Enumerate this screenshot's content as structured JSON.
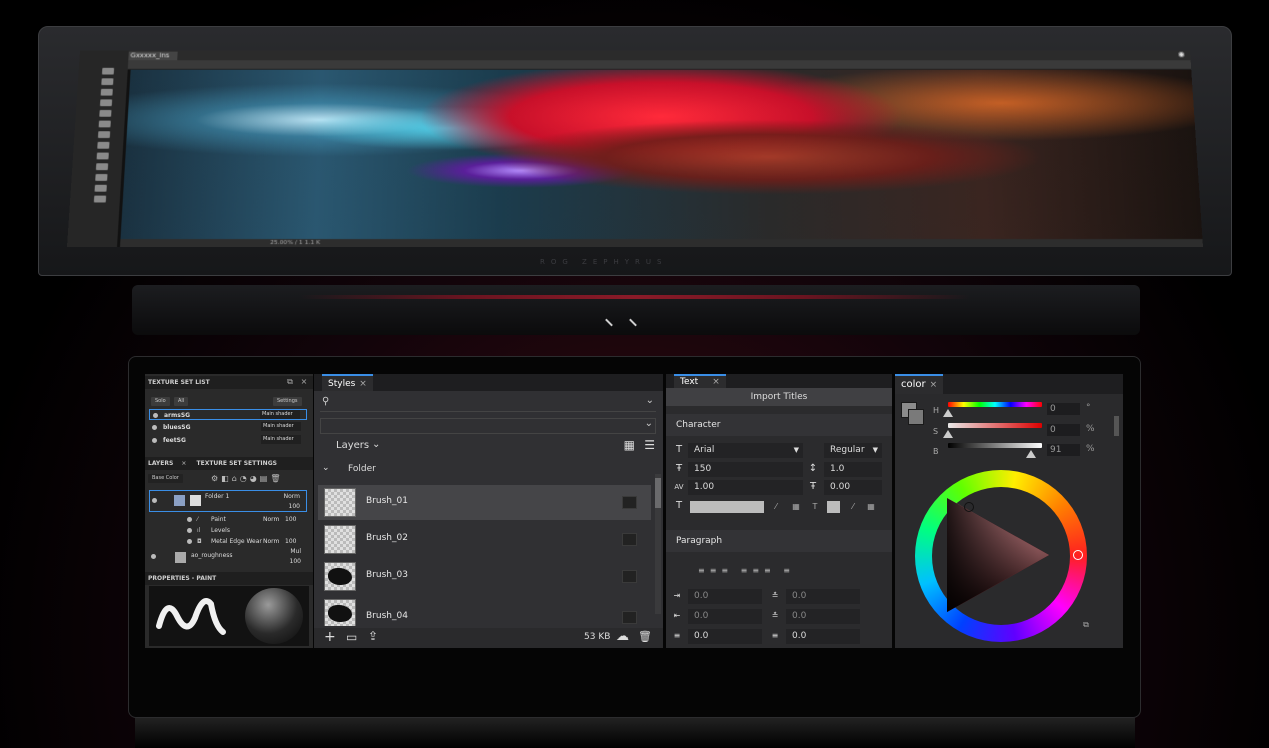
{
  "upper": {
    "tab": "Gxxxxx_ins",
    "status": "25.00% / 1 1.1 K",
    "brand": "ROG ZEPHYRUS"
  },
  "substance": {
    "texture_set_list": "TEXTURE SET LIST",
    "solo": "Solo",
    "all": "All",
    "settings": "Settings",
    "sets": [
      {
        "name": "armsSG",
        "shader": "Main shader"
      },
      {
        "name": "bluesSG",
        "shader": "Main shader"
      },
      {
        "name": "feetSG",
        "shader": "Main shader"
      }
    ],
    "layers_tab": "LAYERS",
    "tss_tab": "TEXTURE SET SETTINGS",
    "channel": "Base Color",
    "folder": "Folder 1",
    "folder_blend": "Norm",
    "folder_opacity": "100",
    "children": [
      {
        "name": "Paint",
        "blend": "Norm",
        "opacity": "100"
      },
      {
        "name": "Levels",
        "blend": "",
        "opacity": ""
      },
      {
        "name": "Metal Edge Wear",
        "blend": "Norm",
        "opacity": "100"
      }
    ],
    "roughness": "ao_roughness",
    "roughness_blend": "Mul",
    "roughness_opacity": "100",
    "properties": "PROPERTIES - PAINT"
  },
  "styles": {
    "tab": "Styles",
    "layers_label": "Layers",
    "folder_label": "Folder",
    "brushes": [
      "Brush_01",
      "Brush_02",
      "Brush_03",
      "Brush_04"
    ],
    "size": "53 KB"
  },
  "text": {
    "tab": "Text",
    "import": "Import Titles",
    "character": "Character",
    "font": "Arial",
    "style": "Regular",
    "size": "150",
    "leading": "1.0",
    "tracking": "1.00",
    "baseline": "0.00",
    "paragraph": "Paragraph",
    "zero": "0.0"
  },
  "color": {
    "tab": "color",
    "h_label": "H",
    "s_label": "S",
    "b_label": "B",
    "h_value": "0",
    "s_value": "0",
    "b_value": "91",
    "h_unit": "°",
    "s_unit": "%",
    "b_unit": "%",
    "accent": "#3a8ee6"
  }
}
